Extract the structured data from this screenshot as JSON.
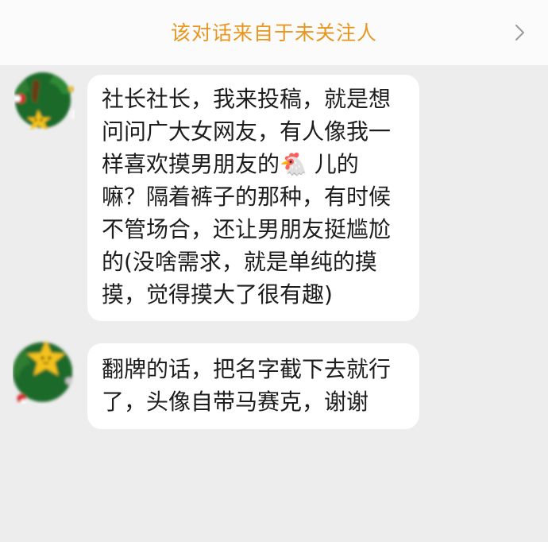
{
  "header": {
    "title": "该对话来自于未关注人",
    "accent_color": "#e8961f"
  },
  "messages": [
    {
      "lines": [
        "社长社长，我来投稿，就是想",
        "问问广大女网友，有人像我一",
        "样喜欢摸男朋友的🐔 儿的",
        "嘛？隔着裤子的那种，有时候",
        "不管场合，还让男朋友挺尴尬",
        "的(没啥需求，就是单纯的摸",
        "摸，觉得摸大了很有趣)"
      ]
    },
    {
      "lines": [
        "翻牌的话，把名字截下去就行",
        "了，头像自带马赛克，谢谢"
      ]
    }
  ],
  "colors": {
    "background": "#ededed",
    "bubble": "#ffffff",
    "avatar_green": "#1f6b2a",
    "avatar_star": "#f4c21f"
  },
  "icons": {
    "header_chevron": "chevron-right-icon",
    "avatar": "avatar-icon"
  }
}
